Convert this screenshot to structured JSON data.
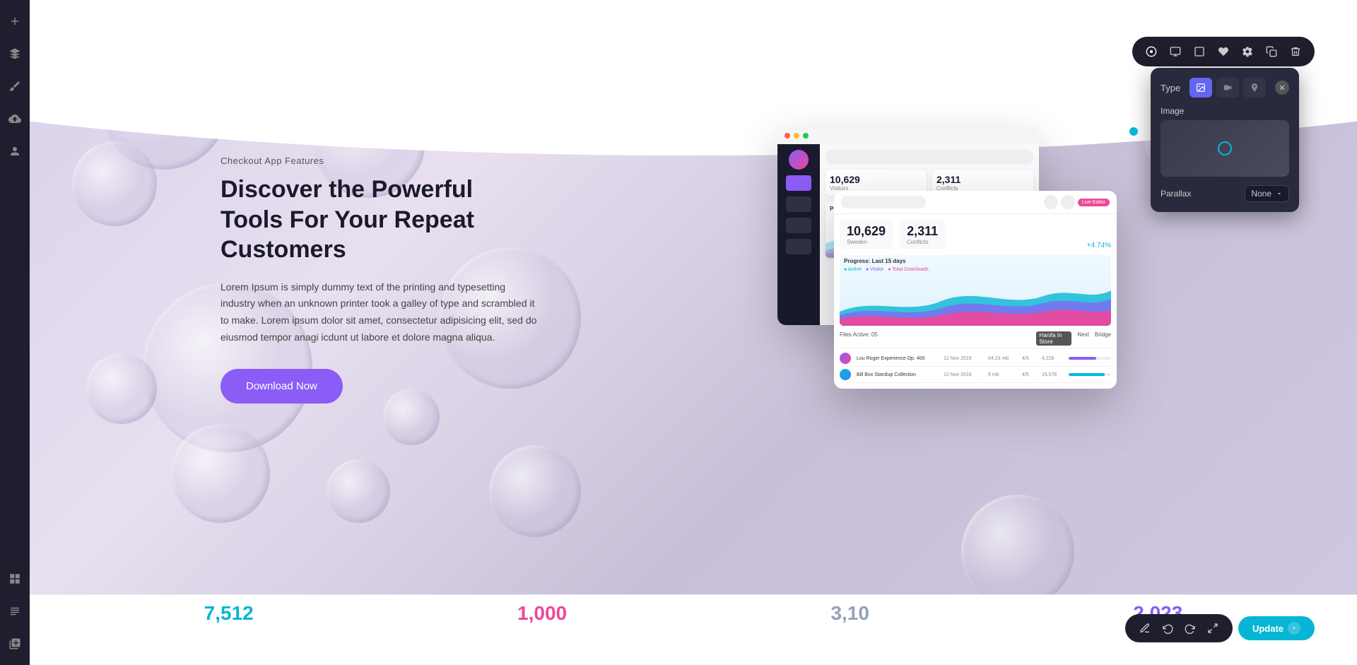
{
  "sidebar": {
    "icons": [
      {
        "name": "plus-icon",
        "symbol": "+"
      },
      {
        "name": "layers-icon",
        "symbol": "≡"
      },
      {
        "name": "paint-icon",
        "symbol": "✎"
      },
      {
        "name": "upload-icon",
        "symbol": "↑"
      },
      {
        "name": "user-icon",
        "symbol": "👤"
      },
      {
        "name": "layout-icon",
        "symbol": "⊞"
      },
      {
        "name": "form-icon",
        "symbol": "☰"
      },
      {
        "name": "menu-icon",
        "symbol": "⋮"
      }
    ]
  },
  "hero": {
    "overline": "Checkout App Features",
    "headline": "Discover the Powerful Tools For Your Repeat Customers",
    "body": "Lorem Ipsum is simply dummy text of the printing and typesetting industry when an unknown printer took a galley of type and scrambled it to make. Lorem ipsum dolor sit amet, consectetur adipisicing elit, sed do eiusmod tempor anagi icdunt ut labore et dolore magna aliqua.",
    "cta": "Download Now"
  },
  "dashboard1": {
    "stats": [
      {
        "num": "10,629",
        "label": "Visitors"
      },
      {
        "num": "2,311",
        "label": "Conflicts"
      }
    ],
    "chart_title": "Progress: Last 15 days"
  },
  "dashboard2": {
    "stats": [
      {
        "num": "10,629",
        "label": "Sweden"
      },
      {
        "num": "2,311",
        "label": "Conflicts"
      }
    ],
    "chart_title": "Progress: Last 15 days",
    "chart_pct": "+4.74%",
    "table_rows": [
      {
        "name": "Lou Roger Experience Op. 400",
        "date": "12 Nov 2019",
        "size": "64.23 mb",
        "val1": "4/5",
        "val2": "4,226"
      },
      {
        "name": "Bill Box Standup Collection",
        "date": "12 Nov 2019",
        "size": "6 mb",
        "val1": "4/5",
        "val2": "15,576"
      }
    ]
  },
  "toolbar": {
    "buttons": [
      {
        "name": "target-icon",
        "symbol": "◎"
      },
      {
        "name": "screen-icon",
        "symbol": "▣"
      },
      {
        "name": "square-icon",
        "symbol": "□"
      },
      {
        "name": "heart-icon",
        "symbol": "♥"
      },
      {
        "name": "settings-icon",
        "symbol": "⚙"
      },
      {
        "name": "copy-icon",
        "symbol": "⧉"
      },
      {
        "name": "trash-icon",
        "symbol": "🗑"
      }
    ]
  },
  "type_panel": {
    "title": "Type",
    "options": [
      {
        "name": "image-type",
        "symbol": "🖼"
      },
      {
        "name": "video-type",
        "symbol": "▶"
      },
      {
        "name": "pin-type",
        "symbol": "📍"
      }
    ],
    "image_label": "Image",
    "parallax_label": "Parallax",
    "parallax_value": "None"
  },
  "bottom_toolbar": {
    "buttons": [
      {
        "name": "pen-icon",
        "symbol": "✏"
      },
      {
        "name": "undo-icon",
        "symbol": "↩"
      },
      {
        "name": "redo-icon",
        "symbol": "↪"
      },
      {
        "name": "expand-icon",
        "symbol": "⤢"
      }
    ],
    "update_label": "Update"
  },
  "bottom_stats": [
    {
      "num": "7,512",
      "color": "cyan"
    },
    {
      "num": "1,000",
      "color": "pink"
    },
    {
      "num": "3,10",
      "color": "gray"
    },
    {
      "num": "2,023",
      "color": "purple"
    }
  ]
}
